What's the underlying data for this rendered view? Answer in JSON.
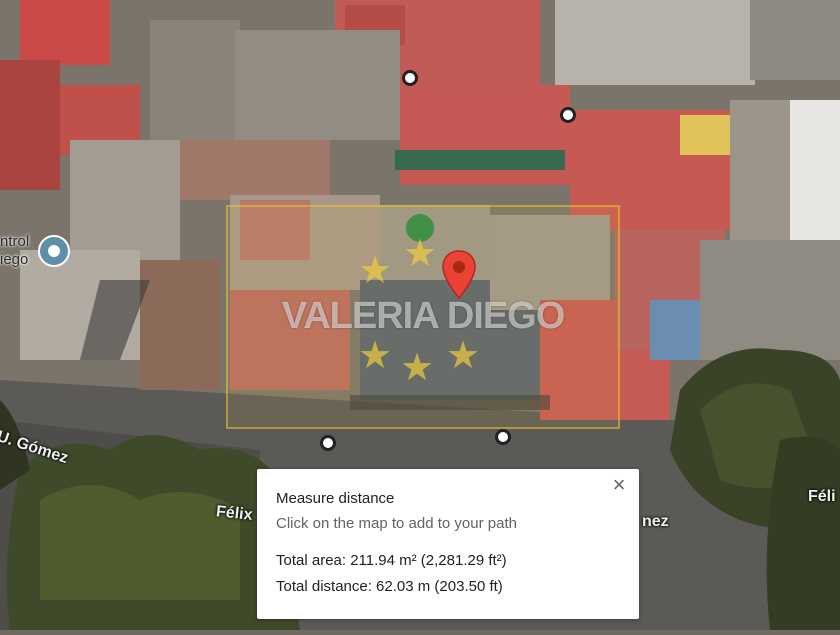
{
  "map": {
    "poi_label_line1": "ntrol",
    "poi_label_line2": "iego",
    "road_label_1": "U. Gómez",
    "road_label_2": "Félix",
    "road_label_3": "nez",
    "road_label_4": "Féli",
    "watermark_text": "VALERIA DIEGO"
  },
  "measure_panel": {
    "title": "Measure distance",
    "hint": "Click on the map to add to your path",
    "total_area": "Total area: 211.94 m² (2,281.29 ft²)",
    "total_distance": "Total distance: 62.03 m (203.50 ft)",
    "close_icon": "×"
  },
  "colors": {
    "pin": "#ea4335",
    "poi_icon": "#5f8ea8"
  }
}
